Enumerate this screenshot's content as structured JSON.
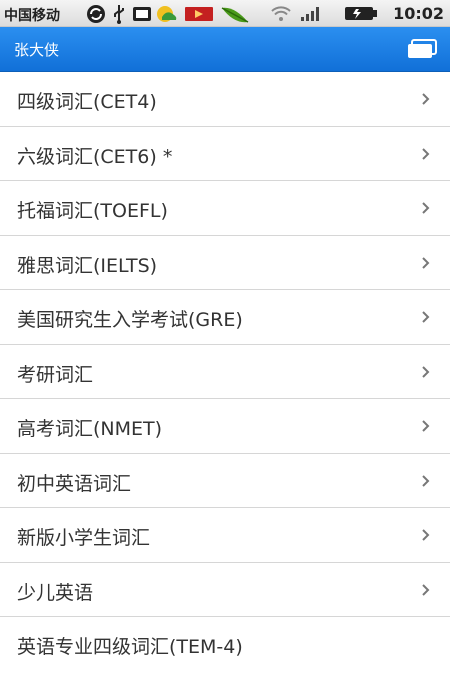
{
  "status_bar": {
    "carrier": "中国移动",
    "time": "10:02",
    "icons": [
      "sync-icon",
      "usb-icon",
      "screenshot-icon",
      "weather-icon",
      "video-icon",
      "leaf-icon",
      "wifi-icon",
      "signal-icon",
      "battery-icon"
    ]
  },
  "title_bar": {
    "title": "张大侠",
    "menu_icon": "window-stack-icon"
  },
  "list": {
    "items": [
      {
        "label": "四级词汇(CET4)"
      },
      {
        "label": "六级词汇(CET6) *"
      },
      {
        "label": "托福词汇(TOEFL)"
      },
      {
        "label": "雅思词汇(IELTS)"
      },
      {
        "label": "美国研究生入学考试(GRE)"
      },
      {
        "label": "考研词汇"
      },
      {
        "label": "高考词汇(NMET)"
      },
      {
        "label": "初中英语词汇"
      },
      {
        "label": "新版小学生词汇"
      },
      {
        "label": "少儿英语"
      },
      {
        "label": "英语专业四级词汇(TEM-4)"
      }
    ]
  },
  "colors": {
    "title_bar": "#1a7fe6",
    "status_bar": "#e8e8e8",
    "text": "#333333",
    "divider": "#d6d6d6"
  }
}
